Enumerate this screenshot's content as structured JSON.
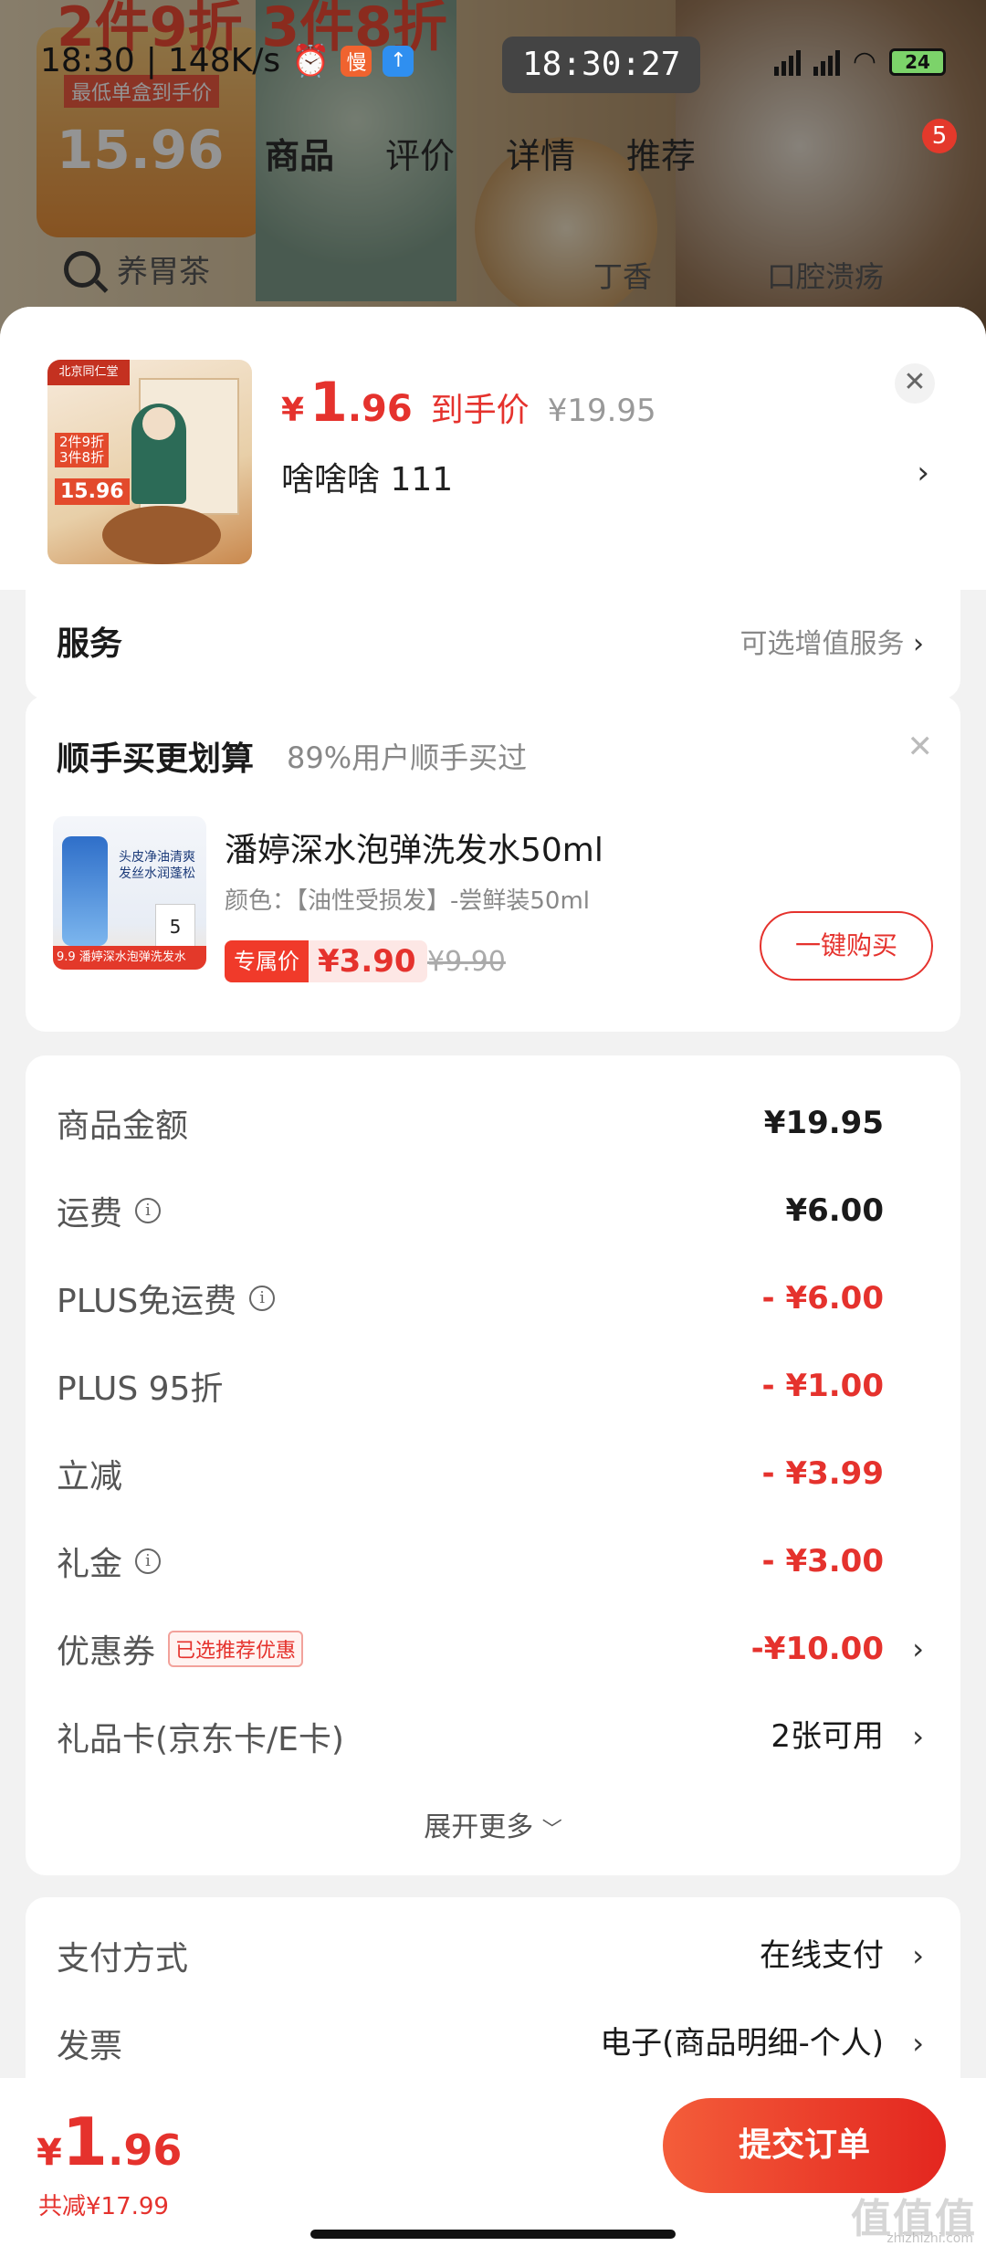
{
  "status": {
    "time": "18:30",
    "speed": "148K/s",
    "clock": "18:30:27",
    "battery": "24"
  },
  "background": {
    "promo_line": "2件9折 3件8折",
    "promo_label": "最低单盒到手价",
    "promo_price": "15.96",
    "tabs": [
      "商品",
      "评价",
      "详情",
      "推荐"
    ],
    "badge": "5",
    "search_text": "养胃茶",
    "chip1": "丁香",
    "chip2": "口腔溃疡"
  },
  "product": {
    "currency": "¥",
    "price_int": "1",
    "price_dec": ".96",
    "price_label": "到手价",
    "original_price": "¥19.95",
    "variant": "啥啥啥  111",
    "img_brand": "北京同仁堂",
    "img_tag1": "2件9折\n3件8折",
    "img_tag2": "15.96"
  },
  "service": {
    "title": "服务",
    "value": "可选增值服务"
  },
  "addon": {
    "title": "顺手买更划算",
    "subtitle": "89%用户顺手买过",
    "name": "潘婷深水泡弹洗发水50ml",
    "spec": "颜色：【油性受损发】-尝鲜装50ml",
    "exclusive_tag": "专属价",
    "price": "¥3.90",
    "old_price": "¥9.90",
    "buy_label": "一键购买",
    "img_text": "头皮净油清爽\n发丝水润蓬松",
    "img_banner": "9.9 潘婷深水泡弹洗发水"
  },
  "fees": [
    {
      "label": "商品金额",
      "value": "¥19.95",
      "info": false,
      "red": false,
      "chevron": false
    },
    {
      "label": "运费",
      "value": "¥6.00",
      "info": true,
      "red": false,
      "chevron": false
    },
    {
      "label": "PLUS免运费",
      "value": "- ¥6.00",
      "info": true,
      "red": true,
      "chevron": false
    },
    {
      "label": "PLUS 95折",
      "value": "- ¥1.00",
      "info": false,
      "red": true,
      "chevron": false
    },
    {
      "label": "立减",
      "value": "- ¥3.99",
      "info": false,
      "red": true,
      "chevron": false
    },
    {
      "label": "礼金",
      "value": "- ¥3.00",
      "info": true,
      "red": true,
      "chevron": false
    },
    {
      "label": "优惠券",
      "value": "-¥10.00",
      "info": false,
      "red": true,
      "chevron": true,
      "tag": "已选推荐优惠"
    },
    {
      "label": "礼品卡(京东卡/E卡)",
      "value": "2张可用",
      "info": false,
      "red": false,
      "chevron": true
    }
  ],
  "expand_label": "展开更多",
  "payment": {
    "method_label": "支付方式",
    "method_value": "在线支付",
    "invoice_label": "发票",
    "invoice_value": "电子(商品明细-个人)"
  },
  "bottom": {
    "currency": "¥",
    "price_int": "1",
    "price_dec": ".96",
    "saved": "共减¥17.99",
    "submit_label": "提交订单",
    "watermark": "值值值",
    "watermark_url": "zhizhizhi.com"
  },
  "colors": {
    "accent": "#e5322d",
    "button_gradient_start": "#f45d3a",
    "button_gradient_end": "#e3261f"
  }
}
